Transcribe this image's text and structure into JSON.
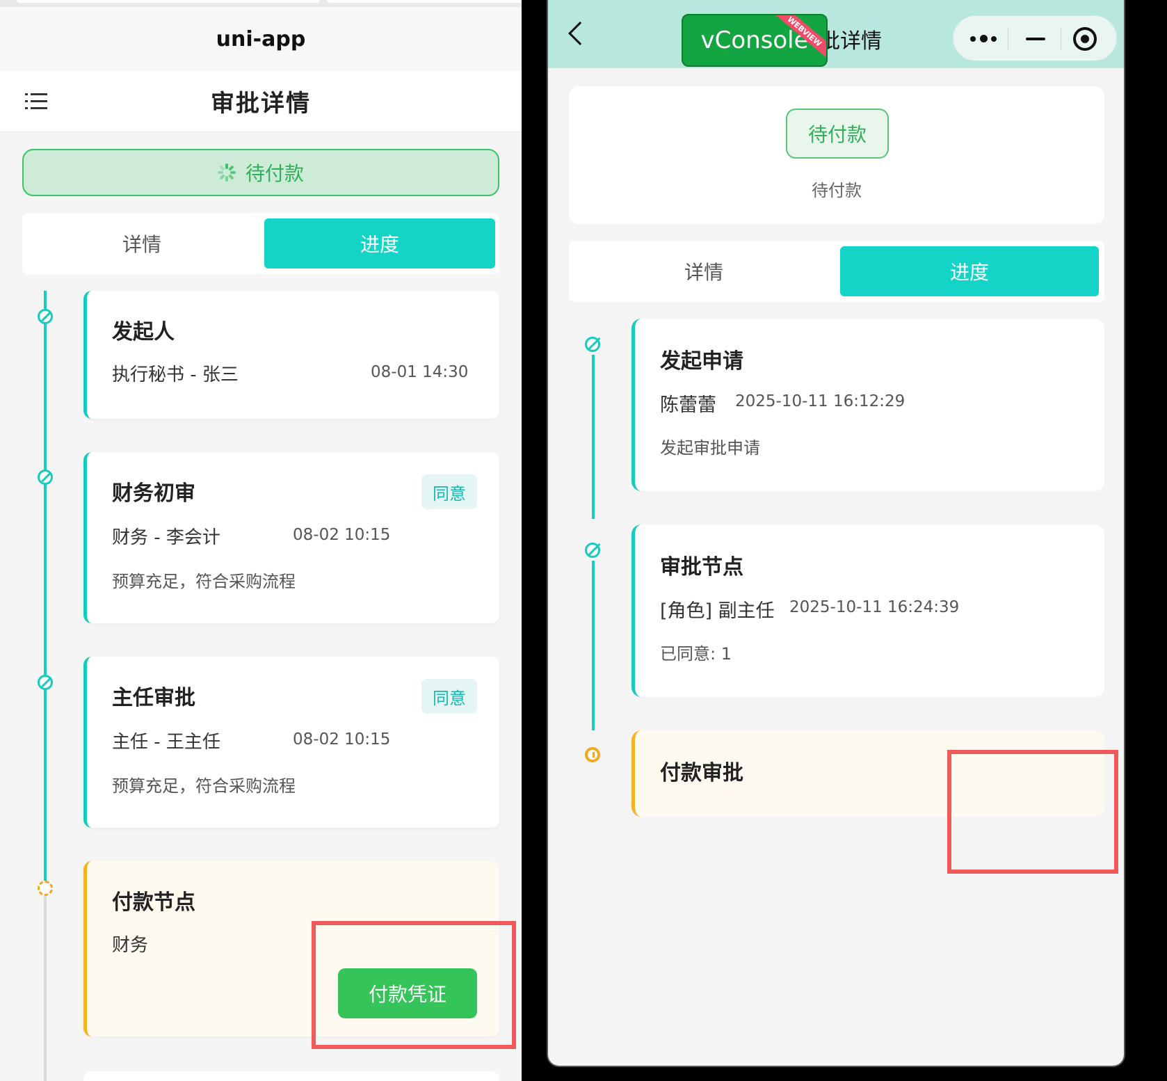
{
  "left": {
    "app_title": "uni-app",
    "page_title": "审批详情",
    "status_label": "待付款",
    "tabs": [
      {
        "label": "详情",
        "active": false
      },
      {
        "label": "进度",
        "active": true
      }
    ],
    "timeline": [
      {
        "title": "发起人",
        "who": "执行秘书 - 张三",
        "time": "08-01 14:30",
        "badge": "",
        "comment": ""
      },
      {
        "title": "财务初审",
        "who": "财务 - 李会计",
        "time": "08-02 10:15",
        "badge": "同意",
        "comment": "预算充足，符合采购流程"
      },
      {
        "title": "主任审批",
        "who": "主任 - 王主任",
        "time": "08-02 10:15",
        "badge": "同意",
        "comment": "预算充足，符合采购流程"
      },
      {
        "title": "付款节点",
        "who": "财务",
        "time": "",
        "badge": "",
        "comment": ""
      }
    ],
    "pay_button_label": "付款凭证"
  },
  "right": {
    "nav_title": "批详情",
    "vconsole_label": "vConsole",
    "vconsole_ribbon": "WEBVIEW",
    "status_pill": "待付款",
    "status_sub": "待付款",
    "tabs": [
      {
        "label": "详情",
        "active": false
      },
      {
        "label": "进度",
        "active": true
      }
    ],
    "timeline": [
      {
        "title": "发起申请",
        "who": "陈蕾蕾",
        "time": "2025-10-11 16:12:29",
        "comment": "发起审批申请"
      },
      {
        "title": "审批节点",
        "who": "[角色] 副主任",
        "time": "2025-10-11 16:24:39",
        "comment": "已同意: 1"
      },
      {
        "title": "付款审批",
        "who": "",
        "time": "",
        "comment": ""
      }
    ]
  },
  "colors": {
    "accent_teal": "#13d4c6",
    "success_green": "#35c45a",
    "pending_orange": "#f5b323",
    "highlight_red": "#f05a5a",
    "nav_mint": "#b8e7de"
  }
}
